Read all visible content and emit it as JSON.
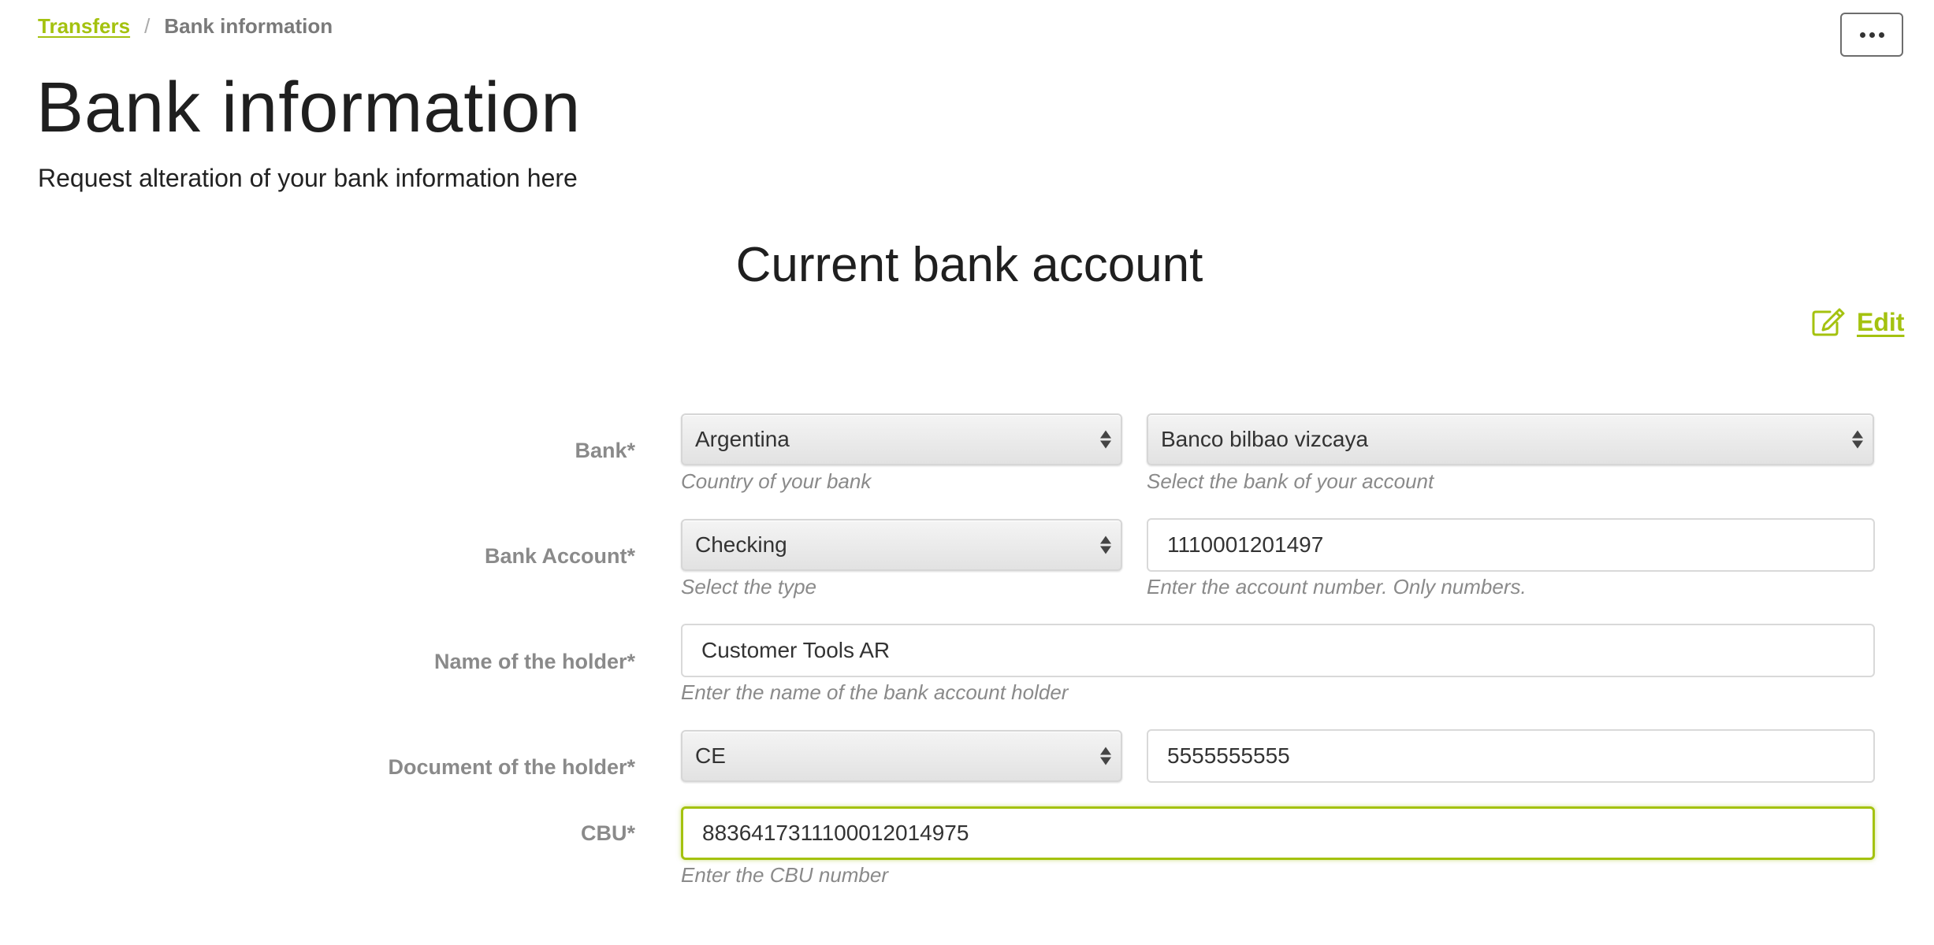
{
  "breadcrumb": {
    "link": "Transfers",
    "separator": "/",
    "current": "Bank information"
  },
  "header": {
    "title": "Bank information",
    "subtitle": "Request alteration of your bank information here"
  },
  "section": {
    "title": "Current bank account",
    "edit_label": "Edit"
  },
  "form": {
    "bank": {
      "label": "Bank*",
      "country": {
        "value": "Argentina",
        "help": "Country of your bank"
      },
      "bank_name": {
        "value": "Banco bilbao vizcaya",
        "help": "Select the bank of your account"
      }
    },
    "account": {
      "label": "Bank Account*",
      "type": {
        "value": "Checking",
        "help": "Select the type"
      },
      "number": {
        "value": "1110001201497",
        "help": "Enter the account number. Only numbers."
      }
    },
    "holder": {
      "label": "Name of the holder*",
      "name": {
        "value": "Customer Tools AR",
        "help": "Enter the name of the bank account holder"
      }
    },
    "document": {
      "label": "Document of the holder*",
      "type": {
        "value": "CE"
      },
      "number": {
        "value": "5555555555"
      }
    },
    "cbu": {
      "label": "CBU*",
      "value": "8836417311100012014975",
      "help": "Enter the CBU number"
    }
  },
  "colors": {
    "accent": "#a4c20f",
    "label": "#8a8a8a"
  },
  "icons": {
    "more": "ellipsis-icon",
    "edit": "edit-icon",
    "select": "select-arrows-icon"
  }
}
